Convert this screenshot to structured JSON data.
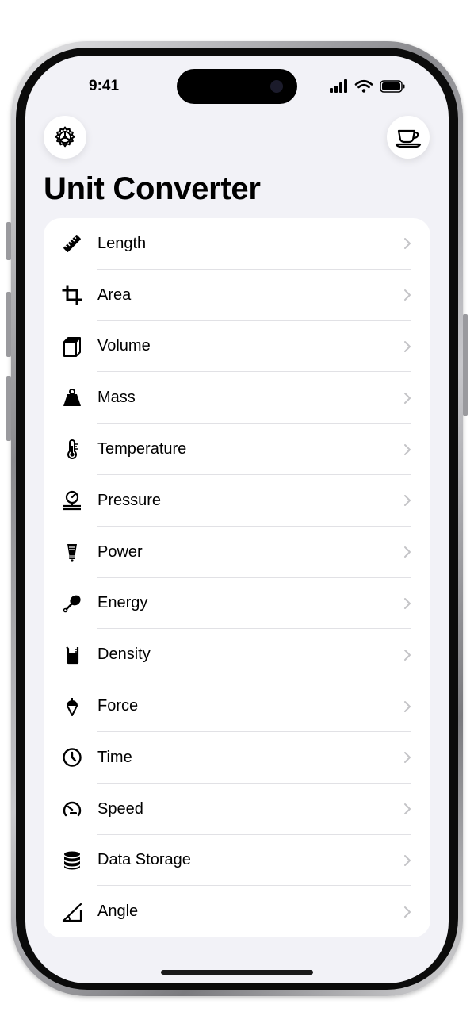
{
  "status_bar": {
    "time": "9:41"
  },
  "header": {
    "title": "Unit Converter",
    "settings_icon": "gear-icon",
    "tip_icon": "coffee-cup-icon"
  },
  "categories": [
    {
      "label": "Length",
      "icon": "ruler-icon"
    },
    {
      "label": "Area",
      "icon": "crop-icon"
    },
    {
      "label": "Volume",
      "icon": "cube-icon"
    },
    {
      "label": "Mass",
      "icon": "scale-weight-icon"
    },
    {
      "label": "Temperature",
      "icon": "thermometer-icon"
    },
    {
      "label": "Pressure",
      "icon": "pressure-gauge-icon"
    },
    {
      "label": "Power",
      "icon": "light-bulb-icon"
    },
    {
      "label": "Energy",
      "icon": "drumstick-icon"
    },
    {
      "label": "Density",
      "icon": "beaker-icon"
    },
    {
      "label": "Force",
      "icon": "plumb-bob-icon"
    },
    {
      "label": "Time",
      "icon": "clock-icon"
    },
    {
      "label": "Speed",
      "icon": "speedometer-icon"
    },
    {
      "label": "Data Storage",
      "icon": "database-icon"
    },
    {
      "label": "Angle",
      "icon": "angle-icon"
    }
  ],
  "colors": {
    "background": "#f2f2f7",
    "card": "#ffffff",
    "text": "#000000",
    "chevron": "#c4c4c7",
    "divider": "#e1e1e5"
  }
}
